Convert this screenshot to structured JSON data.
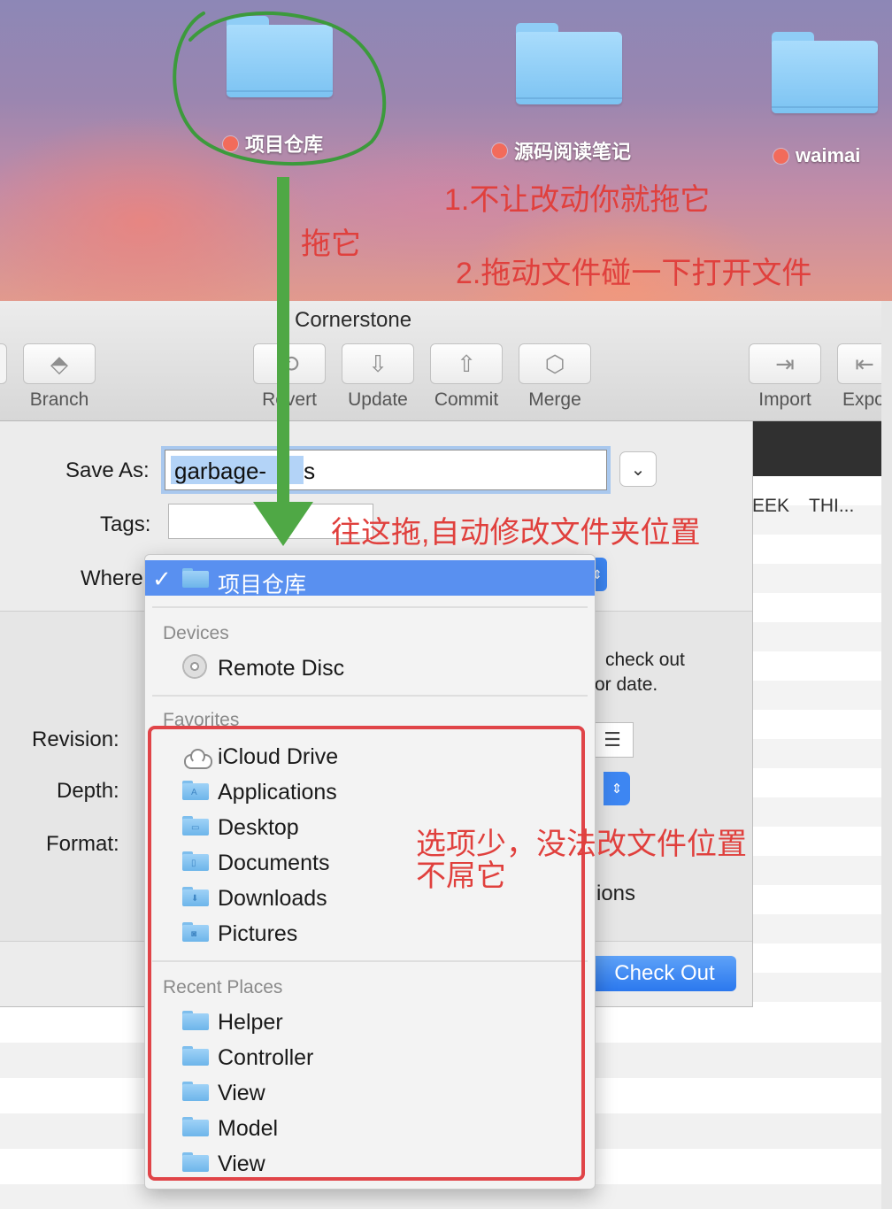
{
  "desktop": {
    "folders": [
      {
        "name": "项目仓库"
      },
      {
        "name": "源码阅读笔记"
      },
      {
        "name": "waimai"
      }
    ],
    "tag_color": "#f26b5b"
  },
  "annotations": {
    "drag_it": "拖它",
    "note_1": "1.不让改动你就拖它",
    "note_2": "2.拖动文件碰一下打开文件",
    "drop_here": "往这拖,自动修改文件夹位置",
    "few_options_1": "选项少，没法改文件位置",
    "few_options_2": "不屌它",
    "annotation_color": "#e0403d",
    "circle_arrow_color": "#3c9a3c"
  },
  "window": {
    "title": "Cornerstone",
    "toolbar": {
      "branch": "Branch",
      "revert": "Revert",
      "update": "Update",
      "commit": "Commit",
      "merge": "Merge",
      "import": "Import",
      "export": "Expo"
    },
    "list_headers": {
      "col1": "EEK",
      "col2": "THI..."
    }
  },
  "sheet": {
    "save_as_label": "Save As:",
    "save_as_value": "garbage-",
    "save_as_tail": "s",
    "tags_label": "Tags:",
    "where_label": "Where",
    "revision_label": "Revision:",
    "depth_label": "Depth:",
    "format_label": "Format:",
    "hint_line1": "check out",
    "hint_line2": "or date.",
    "options_fragment": "ions",
    "checkout_button": "Check Out"
  },
  "popup": {
    "selected": "项目仓库",
    "devices_header": "Devices",
    "devices": [
      {
        "label": "Remote Disc",
        "icon": "disc-icon"
      }
    ],
    "favorites_header": "Favorites",
    "favorites": [
      {
        "label": "iCloud Drive",
        "icon": "cloud-icon"
      },
      {
        "label": "Applications",
        "icon": "applications-folder-icon",
        "glyph": "A"
      },
      {
        "label": "Desktop",
        "icon": "desktop-folder-icon",
        "glyph": "▭"
      },
      {
        "label": "Documents",
        "icon": "documents-folder-icon",
        "glyph": "▯"
      },
      {
        "label": "Downloads",
        "icon": "downloads-folder-icon",
        "glyph": "⬇"
      },
      {
        "label": "Pictures",
        "icon": "pictures-folder-icon",
        "glyph": "◙"
      }
    ],
    "recent_header": "Recent Places",
    "recent": [
      {
        "label": "Helper"
      },
      {
        "label": "Controller"
      },
      {
        "label": "View"
      },
      {
        "label": "Model"
      },
      {
        "label": "View"
      }
    ],
    "accent_color": "#5990f0"
  }
}
